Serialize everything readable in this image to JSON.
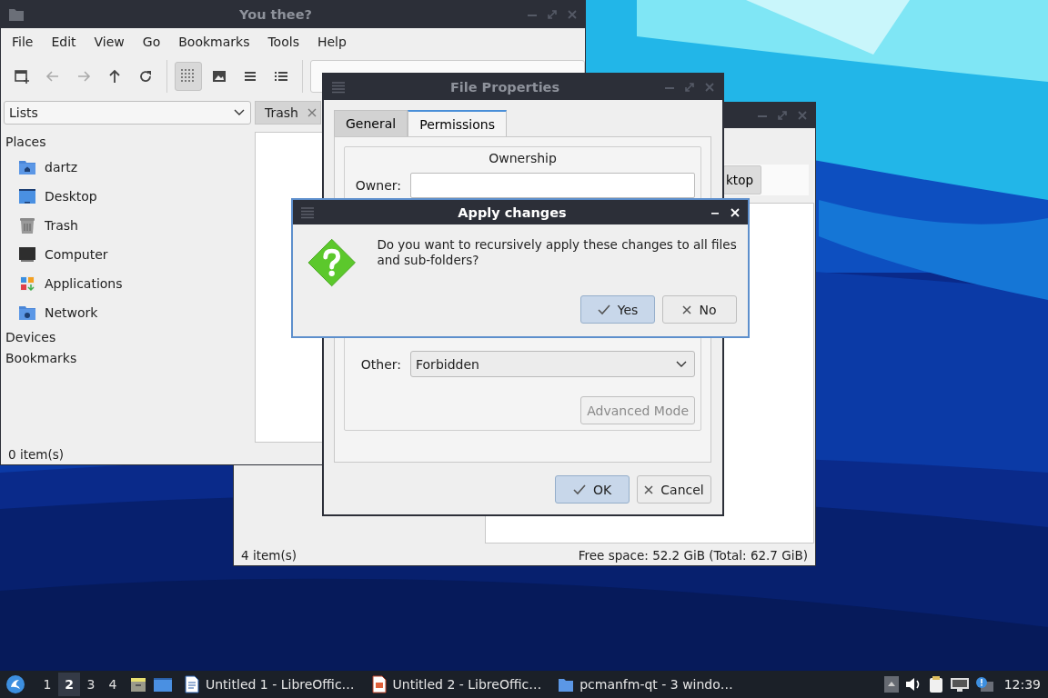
{
  "back_window": {
    "path_button": "ktop",
    "status_left": "4 item(s)",
    "status_right": "Free space: 52.2 GiB (Total: 62.7 GiB)"
  },
  "file_manager": {
    "title": "You thee?",
    "menu": [
      "File",
      "Edit",
      "View",
      "Go",
      "Bookmarks",
      "Tools",
      "Help"
    ],
    "toolbar": [
      {
        "kind": "new_tab",
        "disabled": false
      },
      {
        "kind": "back",
        "disabled": true
      },
      {
        "kind": "forward",
        "disabled": true
      },
      {
        "kind": "up",
        "disabled": false
      },
      {
        "kind": "reload",
        "disabled": false
      }
    ],
    "view_modes": [
      {
        "kind": "icons",
        "selected": true
      },
      {
        "kind": "thumbnails",
        "selected": false
      },
      {
        "kind": "compact",
        "selected": false
      },
      {
        "kind": "details",
        "selected": false
      }
    ],
    "side_pane_mode": "Lists",
    "tab": {
      "label": "Trash"
    },
    "sidebar": [
      {
        "label": "Places",
        "items": [
          {
            "label": "dartz",
            "kind": "home"
          },
          {
            "label": "Desktop",
            "kind": "desktop"
          },
          {
            "label": "Trash",
            "kind": "trash"
          },
          {
            "label": "Computer",
            "kind": "computer"
          },
          {
            "label": "Applications",
            "kind": "apps"
          },
          {
            "label": "Network",
            "kind": "network"
          }
        ]
      },
      {
        "label": "Devices"
      },
      {
        "label": "Bookmarks"
      }
    ],
    "status": "0 item(s)"
  },
  "properties_dialog": {
    "title": "File Properties",
    "tabs": [
      {
        "label": "General",
        "selected": false
      },
      {
        "label": "Permissions",
        "selected": true
      }
    ],
    "group_title": "Ownership",
    "owner_label": "Owner:",
    "other_label": "Other:",
    "other_value": "Forbidden",
    "advanced_button": {
      "label": "Advanced Mode",
      "disabled": true
    },
    "buttons": [
      {
        "label": "OK",
        "kind": "ok",
        "default": true
      },
      {
        "label": "Cancel",
        "kind": "cancel",
        "default": false
      }
    ]
  },
  "confirm_dialog": {
    "title": "Apply changes",
    "message": "Do you want to recursively apply these changes to all files and sub-folders?",
    "buttons": [
      {
        "label": "Yes",
        "kind": "ok",
        "default": true
      },
      {
        "label": "No",
        "kind": "cancel",
        "default": false
      }
    ]
  },
  "taskbar": {
    "desktops": [
      {
        "label": "1",
        "selected": false
      },
      {
        "label": "2",
        "selected": true
      },
      {
        "label": "3",
        "selected": false
      },
      {
        "label": "4",
        "selected": false
      }
    ],
    "tasks": [
      {
        "label": "Untitled 1 - LibreOffic…",
        "kind": "writer"
      },
      {
        "label": "Untitled 2 - LibreOffic…",
        "kind": "impress"
      },
      {
        "label": "pcmanfm-qt - 3 windo…",
        "kind": "folder"
      }
    ],
    "clock": "12:39"
  }
}
